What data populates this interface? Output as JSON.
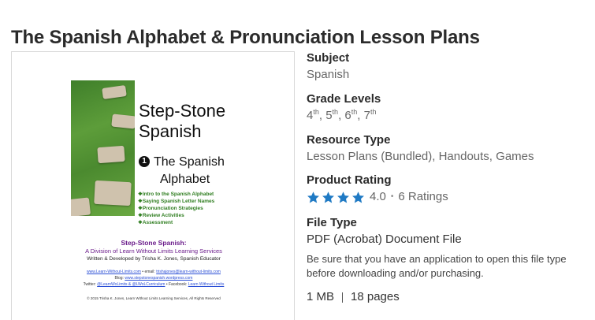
{
  "page": {
    "title": "The Spanish Alphabet & Pronunciation Lesson Plans"
  },
  "cover": {
    "brand_line1": "Step-Stone",
    "brand_line2": "Spanish",
    "number": "1",
    "subtitle_line1": "The Spanish",
    "subtitle_line2": "Alphabet",
    "topics": [
      "Intro to the Spanish Alphabet",
      "Saying Spanish Letter Names",
      "Pronunciation Strategies",
      "Review Activities",
      "Assessment"
    ],
    "credit_title": "Step-Stone Spanish:",
    "credit_line": "A Division of Learn Without Limits Learning Services",
    "credit_author": "Written & Developed by Trisha K. Jones, Spanish Educator",
    "contact_web": "www.Learn-Without-Limits.com",
    "contact_email_label": "email:",
    "contact_email": "trishajones@learn-without-limits.com",
    "contact_blog_label": "Blog:",
    "contact_blog": "www.stepstonespanish.wordpress.com",
    "contact_twitter_label": "Twitter:",
    "contact_twitter": "@LearnWoLimits & @LWoLCurriculum",
    "contact_facebook_label": "Facebook:",
    "contact_facebook": "Learn Without Limits",
    "copyright": "© 2015 Trisha K. Jones, Learn Without Limits Learning Services, All Rights Reserved"
  },
  "details": {
    "subject_label": "Subject",
    "subject_value": "Spanish",
    "grades_label": "Grade Levels",
    "grades": [
      "4",
      "5",
      "6",
      "7"
    ],
    "grade_suffix": "th",
    "resource_label": "Resource Type",
    "resource_value": "Lesson Plans (Bundled), Handouts, Games",
    "rating_label": "Product Rating",
    "rating_value": "4.0",
    "rating_stars": 4,
    "rating_count": "6 Ratings",
    "filetype_label": "File Type",
    "filetype_value": "PDF (Acrobat) Document File",
    "filetype_note": "Be sure that you have an application to open this file type before downloading and/or purchasing.",
    "file_size": "1 MB",
    "page_count": "18 pages"
  },
  "colors": {
    "star": "#1f7ac4",
    "title": "#2b2b2b",
    "accent_purple": "#6a1b8a",
    "accent_green": "#2e7d1f"
  }
}
